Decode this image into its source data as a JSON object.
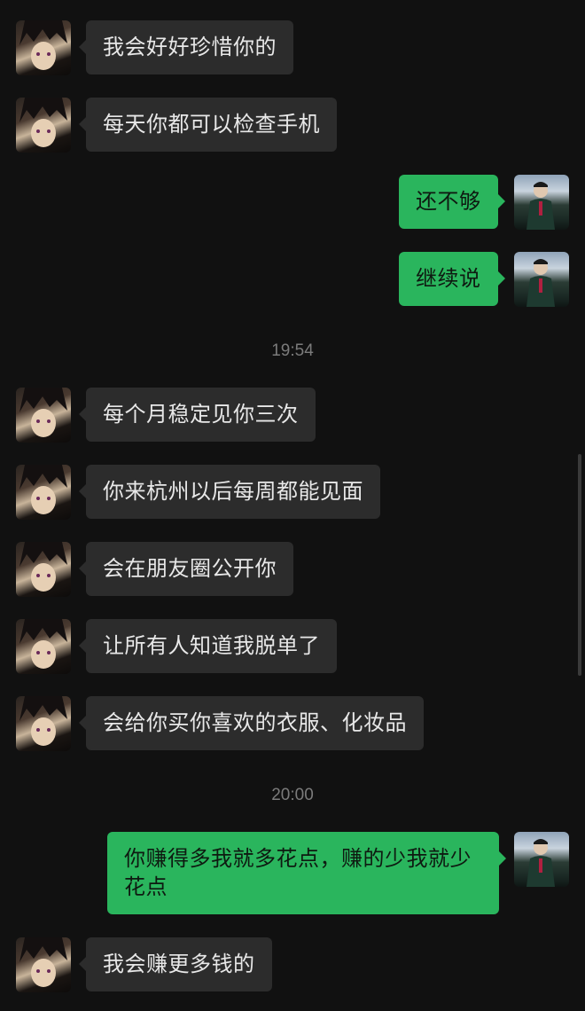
{
  "messages": [
    {
      "side": "peer",
      "text": "我会好好珍惜你的"
    },
    {
      "side": "peer",
      "text": "每天你都可以检查手机"
    },
    {
      "side": "self",
      "text": "还不够"
    },
    {
      "side": "self",
      "text": "继续说"
    },
    {
      "timestamp": "19:54"
    },
    {
      "side": "peer",
      "text": "每个月稳定见你三次"
    },
    {
      "side": "peer",
      "text": "你来杭州以后每周都能见面"
    },
    {
      "side": "peer",
      "text": "会在朋友圈公开你"
    },
    {
      "side": "peer",
      "text": "让所有人知道我脱单了"
    },
    {
      "side": "peer",
      "text": "会给你买你喜欢的衣服、化妆品"
    },
    {
      "timestamp": "20:00"
    },
    {
      "side": "self",
      "text": "你赚得多我就多花点，赚的少我就少\n花点"
    },
    {
      "side": "peer",
      "text": "我会赚更多钱的"
    }
  ],
  "colors": {
    "background": "#111111",
    "peer_bubble": "#2c2c2c",
    "self_bubble": "#2ab55d",
    "timestamp": "#7b7b7b"
  },
  "icons": {
    "peer_avatar": "anime-boy-avatar",
    "self_avatar": "man-in-suit-avatar"
  }
}
